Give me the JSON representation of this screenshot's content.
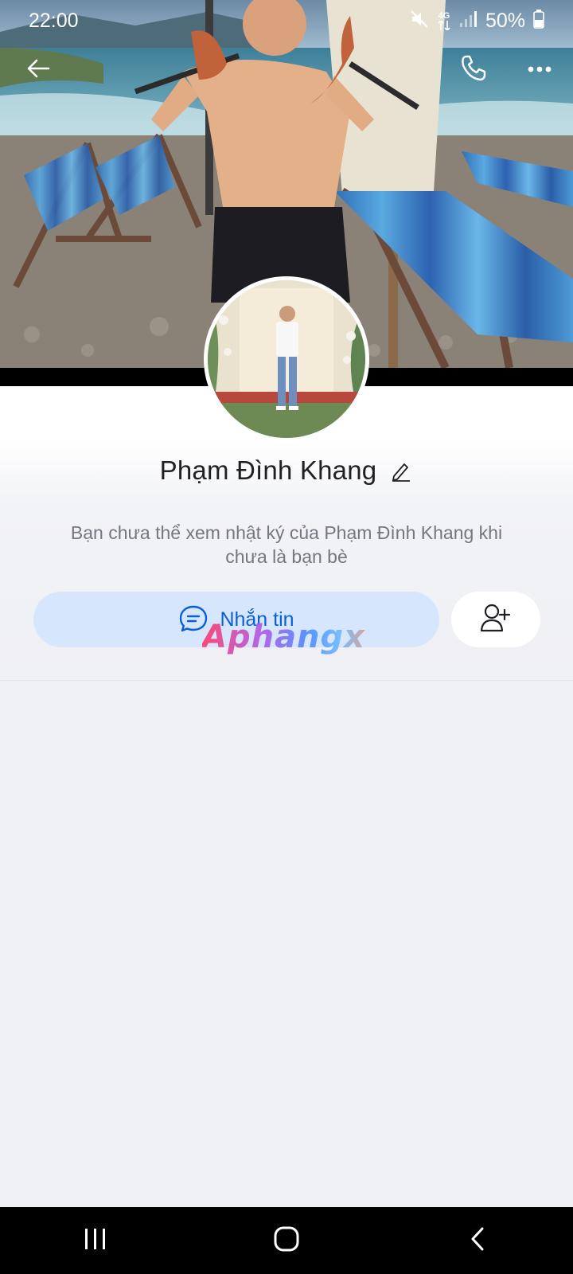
{
  "status_bar": {
    "time": "22:00",
    "network": "4G",
    "battery": "50%",
    "icons": [
      "mute-icon",
      "network-4g-icon",
      "signal-icon",
      "battery-icon"
    ]
  },
  "header": {
    "back_icon": "back-arrow-icon",
    "call_icon": "phone-icon",
    "more_icon": "more-dots-icon"
  },
  "profile": {
    "name": "Phạm Đình Khang",
    "edit_icon": "pencil-icon",
    "privacy_note": "Bạn chưa thể xem nhật ký của Phạm Đình Khang khi chưa là bạn bè"
  },
  "actions": {
    "message_label": "Nhắn tin",
    "message_icon": "chat-bubble-icon",
    "add_friend_icon": "add-friend-icon"
  },
  "watermark": {
    "text": "Aphangx"
  },
  "nav": {
    "recents_icon": "recents-icon",
    "home_icon": "home-icon",
    "back_icon": "nav-back-icon"
  },
  "colors": {
    "accent": "#0b5fd8",
    "message_button_bg": "#d6e7fd",
    "page_bg": "#eff0f4"
  }
}
